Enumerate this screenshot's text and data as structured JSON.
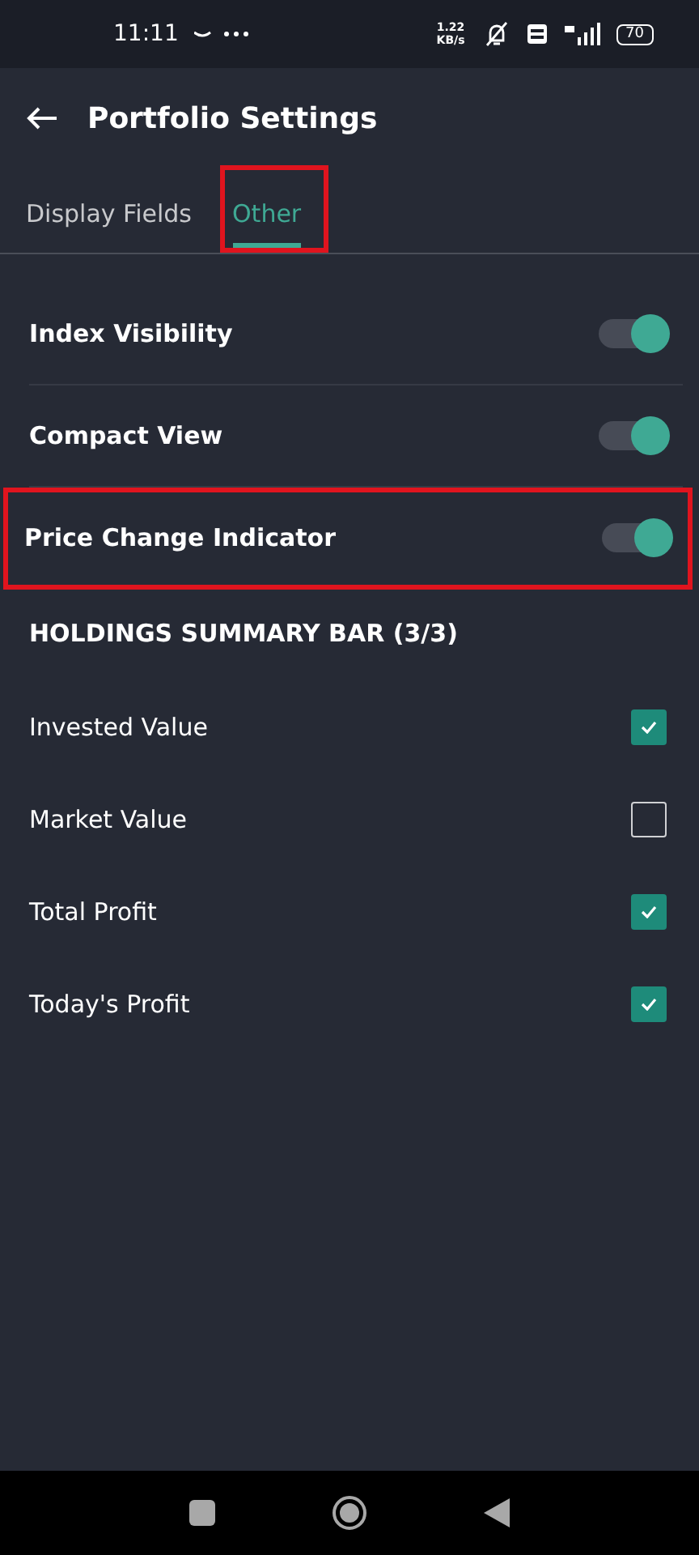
{
  "status_bar": {
    "time": "11:11",
    "speed": "1.22 KB/s",
    "battery": "70"
  },
  "header": {
    "title": "Portfolio Settings"
  },
  "tabs": [
    {
      "label": "Display Fields",
      "selected": false,
      "highlighted": false
    },
    {
      "label": "Other",
      "selected": true,
      "highlighted": true
    }
  ],
  "toggles": [
    {
      "label": "Index Visibility",
      "on": true,
      "highlighted": false
    },
    {
      "label": "Compact View",
      "on": true,
      "highlighted": false
    },
    {
      "label": "Price Change Indicator",
      "on": true,
      "highlighted": true
    }
  ],
  "section": {
    "title": "HOLDINGS SUMMARY BAR (3/3)"
  },
  "checkboxes": [
    {
      "label": "Invested Value",
      "checked": true
    },
    {
      "label": "Market Value",
      "checked": false
    },
    {
      "label": "Total Profit",
      "checked": true
    },
    {
      "label": "Today's Profit",
      "checked": true
    }
  ]
}
